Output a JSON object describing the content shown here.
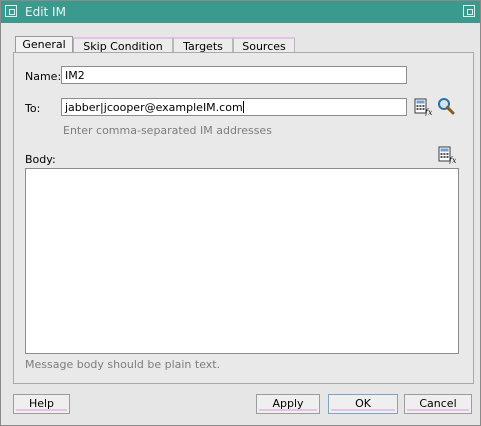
{
  "window": {
    "title": "Edit IM"
  },
  "tabs": [
    {
      "label": "General",
      "active": true
    },
    {
      "label": "Skip Condition",
      "active": false
    },
    {
      "label": "Targets",
      "active": false
    },
    {
      "label": "Sources",
      "active": false
    }
  ],
  "form": {
    "name_label": "Name:",
    "name_value": "IM2",
    "to_label": "To:",
    "to_value": "jabber|jcooper@exampleIM.com",
    "to_hint": "Enter comma-separated IM addresses",
    "body_label": "Body:",
    "body_value": "",
    "body_hint": "Message body should be plain text."
  },
  "icons": {
    "to_expression_builder": "expression-builder-icon",
    "to_search": "search-icon",
    "body_expression_builder": "expression-builder-icon"
  },
  "buttons": {
    "help": "Help",
    "apply": "Apply",
    "ok": "OK",
    "cancel": "Cancel"
  },
  "colors": {
    "titlebar": "#3b9a8e",
    "tab_accent": "#e4c2e4",
    "background": "#e6e6e6"
  }
}
